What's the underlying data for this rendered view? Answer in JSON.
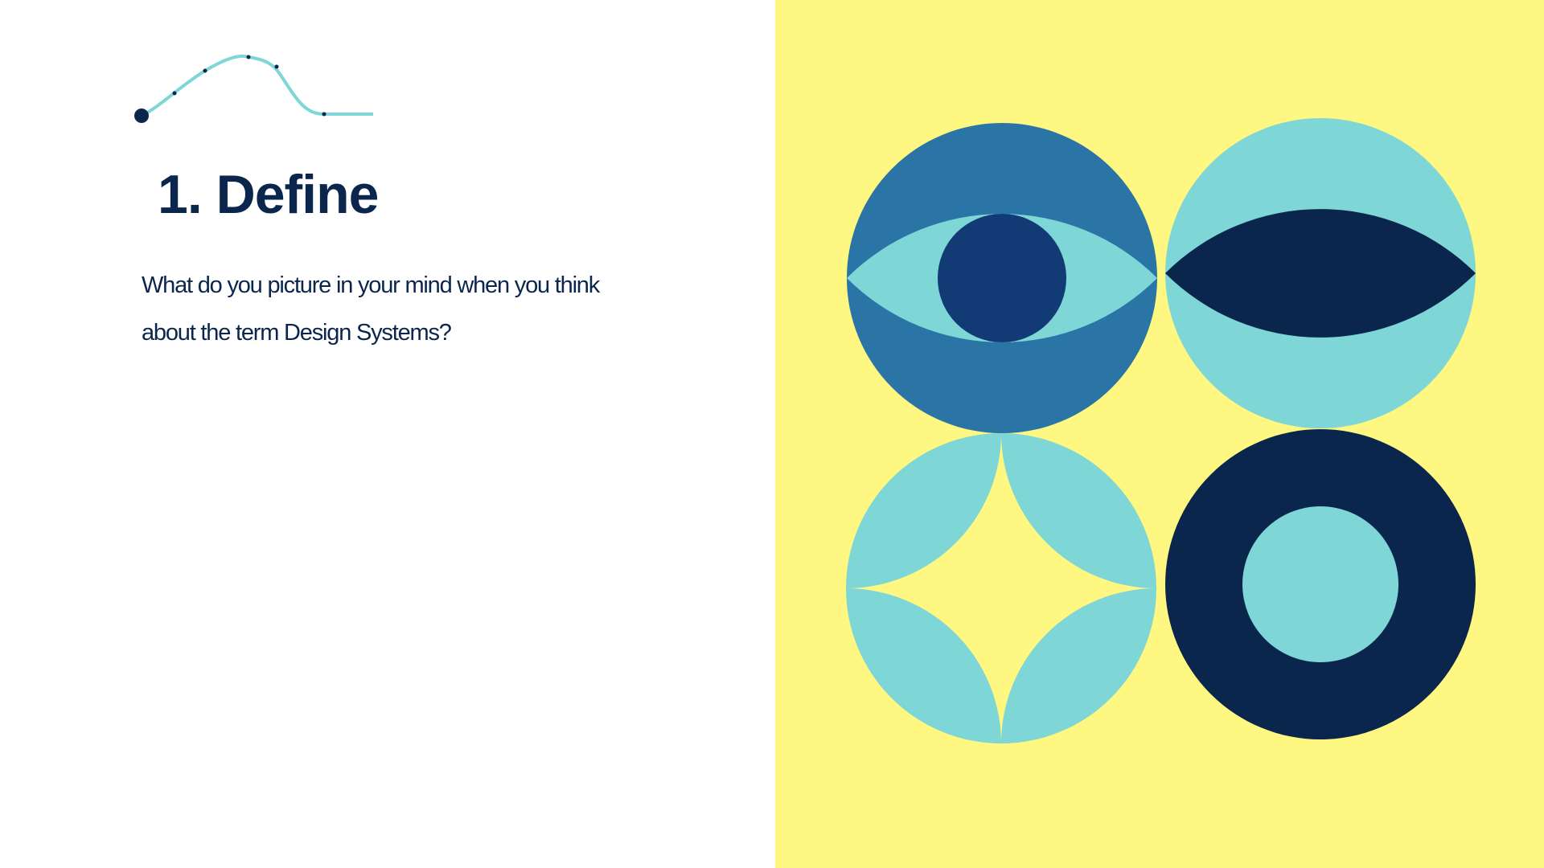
{
  "slide": {
    "title": "1. Define",
    "body": "What do you picture in your mind when you think about the term Design Systems?"
  },
  "colors": {
    "background": "#FFFFFF",
    "panel_yellow": "#FEF882",
    "light_teal": "#7ED6D7",
    "mid_blue": "#2A75A6",
    "navy": "#0B264D",
    "pupil_blue": "#123A75"
  },
  "decorations": [
    "progress-curve-icon",
    "eye-circle",
    "lens-circle",
    "star-circle",
    "ring-circle"
  ]
}
